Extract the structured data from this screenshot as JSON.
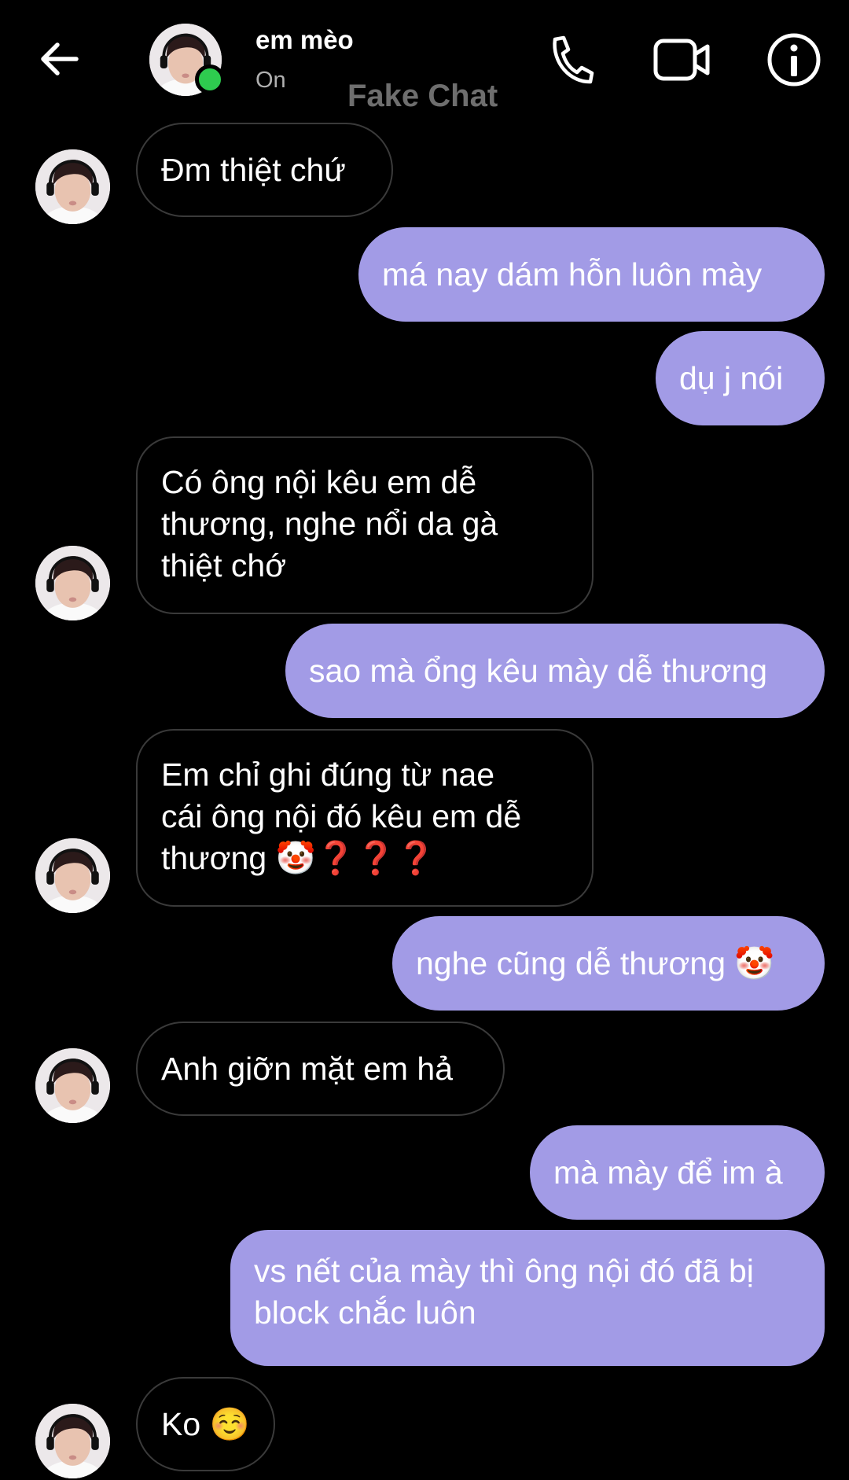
{
  "header": {
    "contact_name": "em mèo",
    "status": "On",
    "watermark": "Fake Chat",
    "icons": [
      "back-arrow-icon",
      "phone-icon",
      "video-camera-icon",
      "info-icon"
    ]
  },
  "messages": [
    {
      "sender": "contact",
      "text": "Đm thiệt chứ"
    },
    {
      "sender": "me",
      "text": "má nay dám hỗn luôn mày"
    },
    {
      "sender": "me",
      "text": "dụ j nói"
    },
    {
      "sender": "contact",
      "text": "Có ông nội kêu em dễ\nthương, nghe nổi da gà\nthiệt chớ"
    },
    {
      "sender": "me",
      "text": "sao mà ổng kêu mày dễ thương"
    },
    {
      "sender": "contact",
      "text": "Em chỉ ghi đúng từ nae\ncái ông nội đó kêu em dễ\nthương 🤡❓❓❓"
    },
    {
      "sender": "me",
      "text": "nghe cũng dễ thương 🤡"
    },
    {
      "sender": "contact",
      "text": "Anh giỡn mặt em hả"
    },
    {
      "sender": "me",
      "text": "mà mày để im à"
    },
    {
      "sender": "me",
      "text": "vs nết của mày thì ông nội đó đã bị\nblock chắc luôn"
    },
    {
      "sender": "contact",
      "text": "Ko ☺️"
    }
  ],
  "colors": {
    "background": "#000000",
    "outgoing_bubble": "#a29be6",
    "incoming_border": "#3a3a3a",
    "online": "#2ecc4f"
  }
}
